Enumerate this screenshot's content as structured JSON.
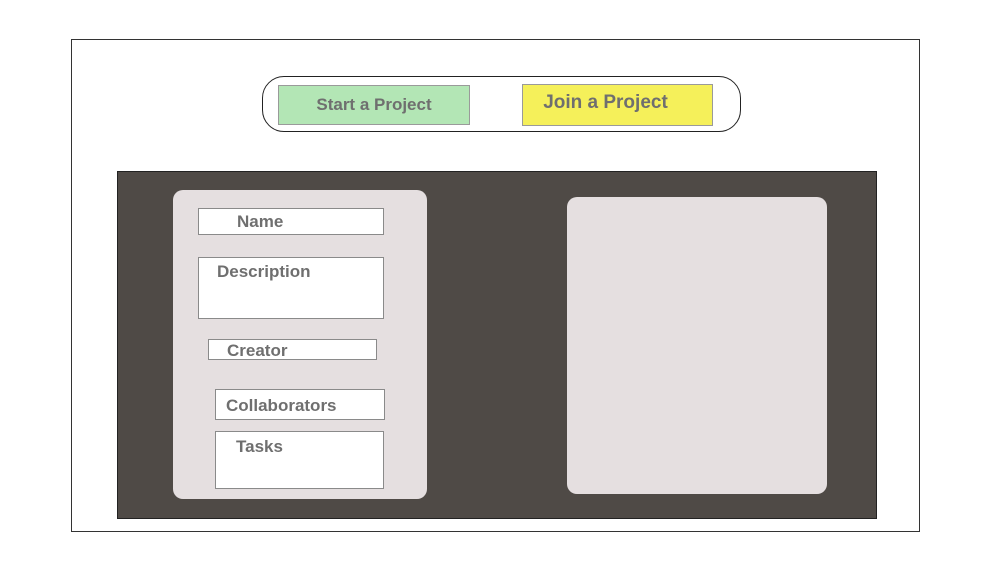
{
  "colors": {
    "start_button_bg": "#b3e6b5",
    "join_button_bg": "#f5f05a",
    "dark_panel_bg": "#4f4a46",
    "card_bg": "#e5dfe0"
  },
  "actions": {
    "start_label": "Start a Project",
    "join_label": "Join a Project"
  },
  "form": {
    "name_label": "Name",
    "description_label": "Description",
    "creator_label": "Creator",
    "collaborators_label": "Collaborators",
    "tasks_label": "Tasks"
  }
}
